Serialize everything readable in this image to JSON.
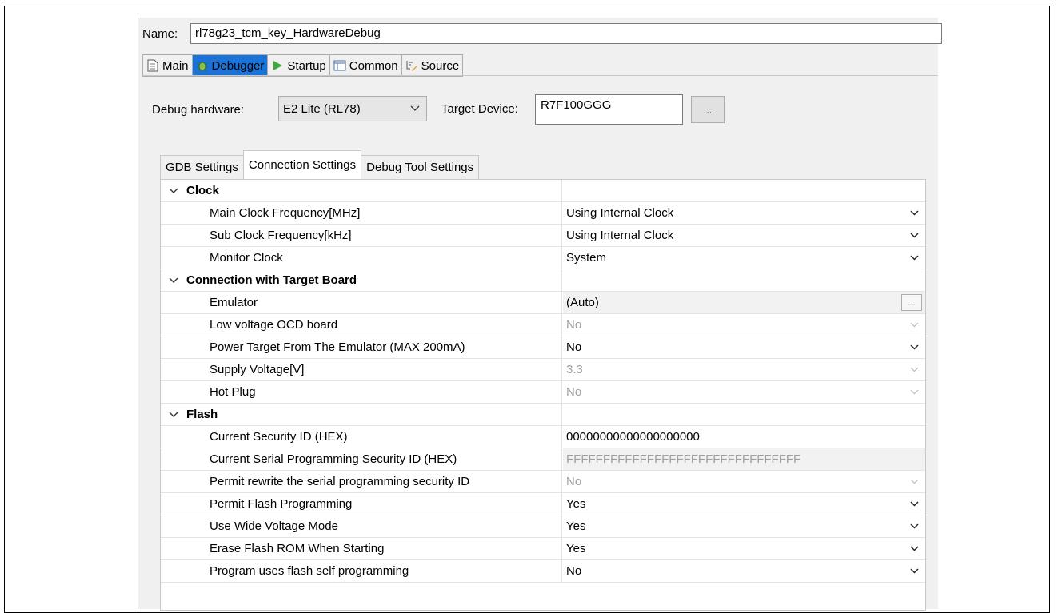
{
  "name": {
    "label": "Name:",
    "value": "rl78g23_tcm_key_HardwareDebug"
  },
  "tabs": [
    {
      "label": "Main",
      "icon": "main-page-icon"
    },
    {
      "label": "Debugger",
      "icon": "debugger-bug-icon",
      "active": true
    },
    {
      "label": "Startup",
      "icon": "startup-play-icon"
    },
    {
      "label": "Common",
      "icon": "common-table-icon"
    },
    {
      "label": "Source",
      "icon": "source-lookup-icon"
    }
  ],
  "debug_hardware": {
    "label": "Debug hardware:",
    "value": "E2 Lite (RL78)"
  },
  "target_device": {
    "label": "Target Device:",
    "value": "R7F100GGG",
    "browse": "..."
  },
  "subtabs": [
    "GDB Settings",
    "Connection Settings",
    "Debug Tool Settings"
  ],
  "categories": [
    {
      "label": "Clock"
    },
    {
      "label": "Connection with Target Board"
    },
    {
      "label": "Flash"
    }
  ],
  "props": [
    {
      "name": "Main Clock Frequency[MHz]",
      "value": "Using Internal Clock"
    },
    {
      "name": "Sub Clock Frequency[kHz]",
      "value": "Using Internal Clock"
    },
    {
      "name": "Monitor Clock",
      "value": "System"
    },
    {
      "name": "Emulator",
      "value": "(Auto)",
      "button": "..."
    },
    {
      "name": "Low voltage OCD board",
      "value": "No"
    },
    {
      "name": "Power Target From The Emulator (MAX 200mA)",
      "value": "No"
    },
    {
      "name": "Supply Voltage[V]",
      "value": "3.3"
    },
    {
      "name": "Hot Plug",
      "value": "No"
    },
    {
      "name": "Current Security ID (HEX)",
      "value": "00000000000000000000"
    },
    {
      "name": "Current Serial Programming Security ID (HEX)",
      "value": "FFFFFFFFFFFFFFFFFFFFFFFFFFFFFFFF"
    },
    {
      "name": "Permit rewrite the serial programming security ID",
      "value": "No"
    },
    {
      "name": "Permit Flash Programming",
      "value": "Yes"
    },
    {
      "name": "Use Wide Voltage Mode",
      "value": "Yes"
    },
    {
      "name": "Erase Flash ROM When Starting",
      "value": "Yes"
    },
    {
      "name": "Program uses flash self programming",
      "value": "No"
    }
  ],
  "colors": {
    "active_tab": "#1a73d9",
    "panel": "#f0f0f0",
    "disabled_text": "#a0a0a0"
  }
}
